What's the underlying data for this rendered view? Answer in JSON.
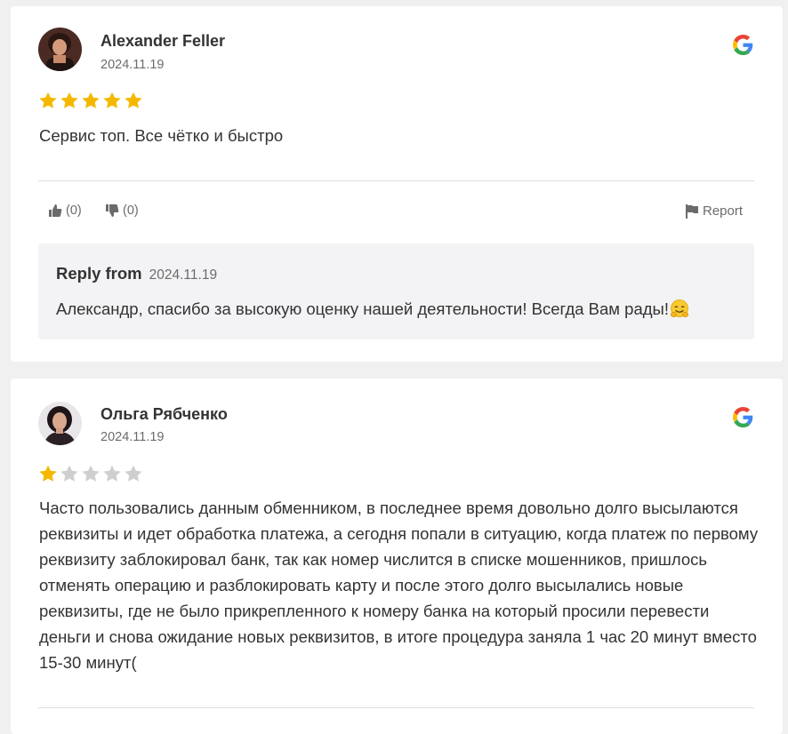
{
  "reviews": [
    {
      "author": "Alexander Feller",
      "date": "2024.11.19",
      "rating": 5,
      "max_rating": 5,
      "text": "Сервис топ. Все чётко и быстро",
      "likes": "(0)",
      "dislikes": "(0)",
      "report_label": "Report",
      "reply": {
        "from_label": "Reply from",
        "date": "2024.11.19",
        "text": "Александр, спасибо за высокую оценку нашей деятельности! Всегда Вам рады!",
        "emoji": "hugging-face-emoji"
      },
      "source_icon": "google-icon"
    },
    {
      "author": "Ольга Рябченко",
      "date": "2024.11.19",
      "rating": 1,
      "max_rating": 5,
      "text": "Часто пользовались данным обменником, в последнее время довольно долго высылаются реквизиты и идет обработка платежа, а сегодня попали в ситуацию, когда платеж по первому реквизиту заблокировал банк, так как номер числится в списке мошенников, пришлось отменять операцию и разблокировать карту и после этого долго высылались новые реквизиты, где не было прикрепленного к номеру банка на который просили перевести деньги и снова ожидание новых реквизитов, в итоге процедура заняла 1 час 20 минут вместо 15-30 минут(",
      "source_icon": "google-icon"
    }
  ],
  "colors": {
    "page_bg": "#f0f0f0",
    "card_bg": "#ffffff",
    "star_filled": "#f5b800",
    "star_empty": "#cfcfcf",
    "reply_bg": "#f3f3f5",
    "muted_text": "#6b6b6b"
  }
}
